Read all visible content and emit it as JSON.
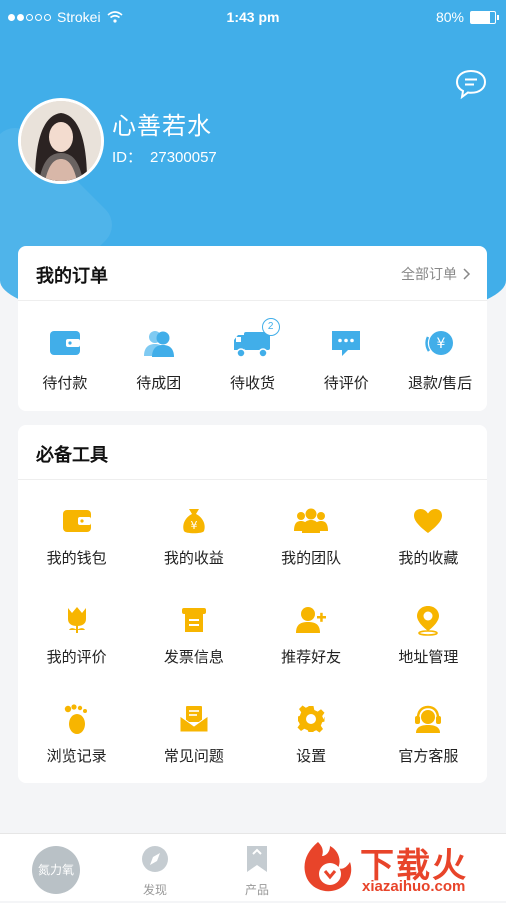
{
  "status_bar": {
    "carrier": "Strokei",
    "time": "1:43 pm",
    "battery": "80%",
    "battery_level": 0.8
  },
  "profile": {
    "name": "心善若水",
    "id_label": "ID：",
    "id_value": "27300057"
  },
  "orders": {
    "title": "我的订单",
    "all_label": "全部订单",
    "items": [
      {
        "label": "待付款",
        "icon": "wallet-icon"
      },
      {
        "label": "待成团",
        "icon": "group-icon"
      },
      {
        "label": "待收货",
        "icon": "truck-icon",
        "badge": "2"
      },
      {
        "label": "待评价",
        "icon": "comment-icon"
      },
      {
        "label": "退款/售后",
        "icon": "refund-icon"
      }
    ]
  },
  "tools": {
    "title": "必备工具",
    "items": [
      {
        "label": "我的钱包",
        "icon": "wallet-icon"
      },
      {
        "label": "我的收益",
        "icon": "money-bag-icon"
      },
      {
        "label": "我的团队",
        "icon": "team-icon"
      },
      {
        "label": "我的收藏",
        "icon": "heart-icon"
      },
      {
        "label": "我的评价",
        "icon": "flower-icon"
      },
      {
        "label": "发票信息",
        "icon": "invoice-icon"
      },
      {
        "label": "推荐好友",
        "icon": "add-friend-icon"
      },
      {
        "label": "地址管理",
        "icon": "location-icon"
      },
      {
        "label": "浏览记录",
        "icon": "footprint-icon"
      },
      {
        "label": "常见问题",
        "icon": "mail-icon"
      },
      {
        "label": "设置",
        "icon": "gear-icon"
      },
      {
        "label": "官方客服",
        "icon": "headset-icon"
      }
    ]
  },
  "tabbar": {
    "home_label": "氮力氧",
    "discover_label": "发现",
    "products_label": "产品"
  },
  "watermark": {
    "text": "下载火",
    "url_text": "xiazaihuo.com"
  },
  "colors": {
    "primary": "#41aee9",
    "accent": "#f7b500",
    "watermark": "#e8442a"
  }
}
